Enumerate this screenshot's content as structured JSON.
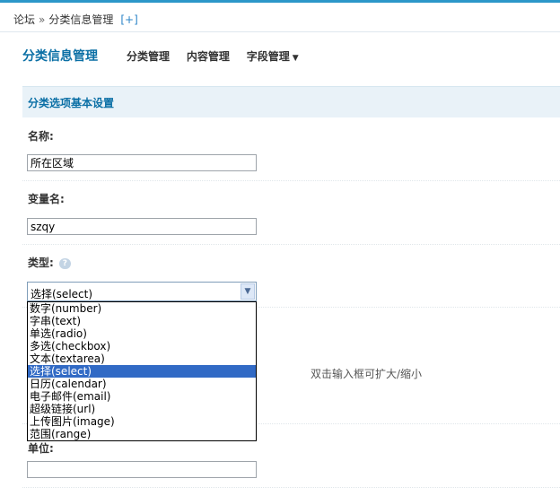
{
  "breadcrumb": {
    "items": [
      "论坛",
      "分类信息管理"
    ],
    "separator": "»",
    "add_label": "[+]"
  },
  "header": {
    "title": "分类信息管理",
    "tabs": [
      {
        "label": "分类管理"
      },
      {
        "label": "内容管理"
      },
      {
        "label": "字段管理"
      }
    ],
    "dropdown_arrow": "▼"
  },
  "section": {
    "title": "分类选项基本设置"
  },
  "form": {
    "name_label": "名称:",
    "name_value": "所在区域",
    "var_label": "变量名:",
    "var_value": "szqy",
    "type_label": "类型:",
    "type_selected": "选择(select)",
    "type_options": [
      "数字(number)",
      "字串(text)",
      "单选(radio)",
      "多选(checkbox)",
      "文本(textarea)",
      "选择(select)",
      "日历(calendar)",
      "电子邮件(email)",
      "超级链接(url)",
      "上传图片(image)",
      "范围(range)"
    ],
    "selected_index": 5,
    "hint": "双击输入框可扩大/缩小",
    "partial_label": "单位:",
    "unit_value": ""
  },
  "icons": {
    "help": "help-icon",
    "select_arrow": "chevron-down-icon"
  },
  "colors": {
    "accent": "#2c97c9",
    "title": "#0a6fa5",
    "section_bg": "#e9f2f8",
    "selected_option": "#316ac5"
  }
}
